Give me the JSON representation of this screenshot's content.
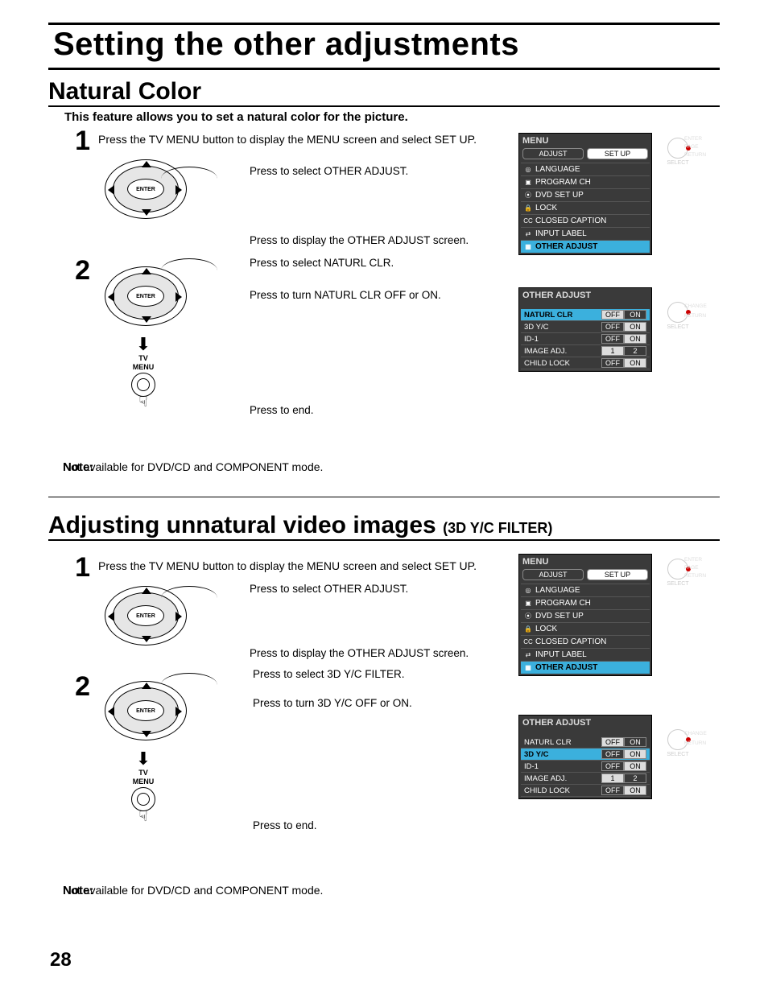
{
  "page_number": "28",
  "title": "Setting the other adjustments",
  "section_a": {
    "heading": "Natural Color",
    "intro": "This feature allows you to set a natural color for the picture.",
    "step1_num": "1",
    "step1_text": "Press the TV MENU button to display the MENU screen and select SET UP.",
    "desc1": "Press to select OTHER ADJUST.",
    "desc2": "Press to display the OTHER ADJUST screen.",
    "step2_num": "2",
    "desc3": "Press to select NATURL CLR.",
    "desc4": "Press to turn NATURL CLR OFF or ON.",
    "tv_label_1": "TV",
    "tv_label_2": "MENU",
    "desc_end": "Press to end.",
    "note_label": "Note:",
    "note_text": "Not available for DVD/CD and COMPONENT mode.",
    "enter_label": "ENTER"
  },
  "section_b": {
    "heading": "Adjusting unnatural video images",
    "heading_sub": "(3D Y/C FILTER)",
    "step1_num": "1",
    "step1_text": "Press the TV MENU button to display the MENU screen and select SET UP.",
    "desc1": "Press to select OTHER ADJUST.",
    "desc2": "Press to display the OTHER ADJUST screen.",
    "step2_num": "2",
    "desc3": "Press to select 3D Y/C FILTER.",
    "desc4": "Press to turn 3D Y/C OFF or ON.",
    "tv_label_1": "TV",
    "tv_label_2": "MENU",
    "desc_end": "Press to end.",
    "note_label": "Note:",
    "note_text": "Not available for DVD/CD and COMPONENT mode.",
    "enter_label": "ENTER"
  },
  "osd_menu": {
    "title": "MENU",
    "tab1": "ADJUST",
    "tab2": "SET UP",
    "items": [
      {
        "icon": "◎",
        "label": "LANGUAGE"
      },
      {
        "icon": "▣",
        "label": "PROGRAM CH"
      },
      {
        "icon": "⦿",
        "label": "DVD SET UP"
      },
      {
        "icon": "🔒",
        "label": "LOCK"
      },
      {
        "icon": "CC",
        "label": "CLOSED CAPTION"
      },
      {
        "icon": "⇄",
        "label": "INPUT LABEL"
      },
      {
        "icon": "▦",
        "label": "OTHER ADJUST",
        "hl": true
      }
    ],
    "hints": {
      "enter": "ENTER",
      "page": "PAGE",
      "return": "RETURN",
      "select": "SELECT"
    }
  },
  "osd_other_a": {
    "title": "OTHER ADJUST",
    "rows": [
      {
        "name": "NATURL CLR",
        "opts": [
          "OFF",
          "ON"
        ],
        "sel": 0,
        "hl": true
      },
      {
        "name": "3D Y/C",
        "opts": [
          "OFF",
          "ON"
        ],
        "sel": 1
      },
      {
        "name": "ID-1",
        "opts": [
          "OFF",
          "ON"
        ],
        "sel": 1
      },
      {
        "name": "IMAGE ADJ.",
        "opts": [
          "1",
          "2"
        ],
        "sel": 0
      },
      {
        "name": "CHILD LOCK",
        "opts": [
          "OFF",
          "ON"
        ],
        "sel": 1
      }
    ],
    "hints": {
      "change": "CHANGE",
      "return": "RETURN",
      "select": "SELECT"
    }
  },
  "osd_other_b": {
    "title": "OTHER ADJUST",
    "rows": [
      {
        "name": "NATURL CLR",
        "opts": [
          "OFF",
          "ON"
        ],
        "sel": 0
      },
      {
        "name": "3D Y/C",
        "opts": [
          "OFF",
          "ON"
        ],
        "sel": 1,
        "hl": true
      },
      {
        "name": "ID-1",
        "opts": [
          "OFF",
          "ON"
        ],
        "sel": 1
      },
      {
        "name": "IMAGE ADJ.",
        "opts": [
          "1",
          "2"
        ],
        "sel": 0
      },
      {
        "name": "CHILD LOCK",
        "opts": [
          "OFF",
          "ON"
        ],
        "sel": 1
      }
    ],
    "hints": {
      "change": "CHANGE",
      "return": "RETURN",
      "select": "SELECT"
    }
  }
}
